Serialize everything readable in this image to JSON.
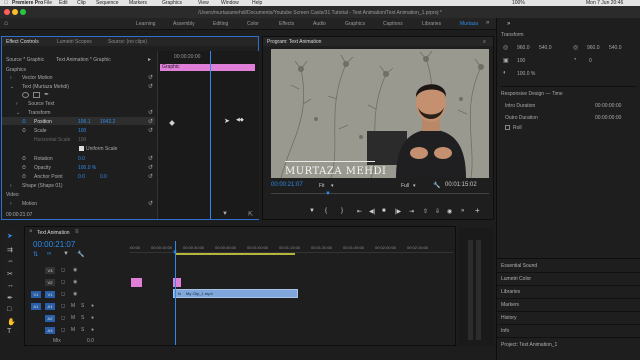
{
  "menubar": {
    "app": "Premiere Pro",
    "items": [
      "File",
      "Edit",
      "Clip",
      "Sequence",
      "Markers",
      "Graphics",
      "View",
      "Window",
      "Help"
    ],
    "battery": "100%",
    "datetime": "Mon 7 Jun 20:46"
  },
  "titlebar": {
    "path": "/Users/murtazamehdi/Documents/Youtube Screen Casts/31 Tutorial - Text Animation/Text Animation_1.prproj *"
  },
  "workspaces": [
    "Learning",
    "Assembly",
    "Editing",
    "Color",
    "Effects",
    "Audio",
    "Graphics",
    "Captions",
    "Libraries",
    "Murtaza"
  ],
  "workspace_active": "Murtaza",
  "effect_controls": {
    "tabs": [
      "Effect Controls",
      "Lumetri Scopes",
      "Source: (no clips)"
    ],
    "source_label": "Source * Graphic",
    "source_target": "Text Animation * Graphic",
    "mini_timecode": "00:00:20:00",
    "graphic_clip": "Graphic",
    "section_graphics": "Graphics",
    "vector_motion": "Vector Motion",
    "text_layer": "Text (Murtaza Mehdi)",
    "source_text": "Source Text",
    "transform": "Transform",
    "position": {
      "label": "Position",
      "x": "106.1",
      "y": "1042.2"
    },
    "scale": {
      "label": "Scale",
      "value": "100"
    },
    "scale_width": {
      "label": "Horizontal Scale",
      "value": "100"
    },
    "uniform_scale": "Uniform Scale",
    "rotation": {
      "label": "Rotation",
      "value": "0.0"
    },
    "opacity": {
      "label": "Opacity",
      "value": "100.0 %"
    },
    "anchor": {
      "label": "Anchor Point",
      "x": "0.0",
      "y": "0.0"
    },
    "shape": "Shape (Shape 01)",
    "section_video": "Video",
    "motion": "Motion",
    "timecode": "00:00:21:07"
  },
  "program": {
    "tab": "Program: Text Animation",
    "lower_third": "MURTAZA MEHDI",
    "timecode": "00:00:21:07",
    "fit": "Fit",
    "quality": "Full",
    "duration": "00:01:15:02"
  },
  "properties": {
    "transform_label": "Transform",
    "pos_x": "960.0",
    "pos_y": "540.0",
    "anchor_x": "960.0",
    "anchor_y": "540.0",
    "scale": "100",
    "rotation": "0",
    "opacity": "100.0 %",
    "responsive_title": "Responsive Design — Time",
    "intro_label": "Intro Duration",
    "intro_value": "00:00:00:00",
    "outro_label": "Outro Duration",
    "outro_value": "00:00:00:00",
    "roll": "Roll"
  },
  "libraries": {
    "items": [
      "Essential Sound",
      "Lumetri Color",
      "Libraries",
      "Markers",
      "History",
      "Info",
      "Project: Text Animation_1"
    ]
  },
  "timeline": {
    "tab": "Text Animation",
    "timecode": "00:00:21:07",
    "ticks": [
      ":00:00",
      "00:00:15:00",
      "00:00:30:00",
      "00:00:45:00",
      "00:01:00:00",
      "00:01:15:00",
      "00:01:30:00",
      "00:01:45:00",
      "00:02:00:00",
      "00:02:15:00"
    ],
    "video_tracks": [
      "V3",
      "V2",
      "V1"
    ],
    "audio_tracks": [
      "A1",
      "A2",
      "A3"
    ],
    "source_v": "V1",
    "source_a": "A1",
    "mix": "Mix",
    "mix_value": "0.0",
    "clip_name": "My Clip_1.mp4",
    "clip_color_pink": "#e07fd8",
    "clip_color_blue": "#7fa7dc"
  },
  "accent": "#2d8ceb"
}
